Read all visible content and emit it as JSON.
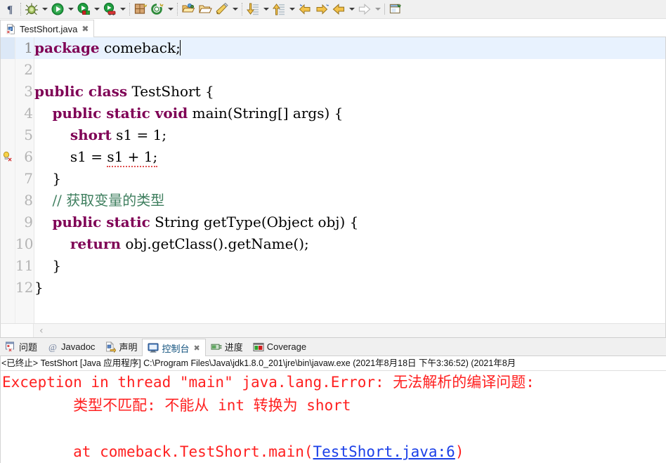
{
  "toolbar": {
    "items": [
      {
        "name": "paragraph-mark-icon",
        "type": "icon"
      },
      {
        "name": "separator-dots",
        "type": "sep-dots"
      },
      {
        "name": "debug-icon",
        "type": "icon"
      },
      {
        "name": "debug-dropdown-arrow",
        "type": "arrow"
      },
      {
        "name": "run-icon",
        "type": "icon"
      },
      {
        "name": "run-dropdown-arrow",
        "type": "arrow"
      },
      {
        "name": "run-coverage-icon",
        "type": "icon"
      },
      {
        "name": "coverage-dropdown-arrow",
        "type": "arrow"
      },
      {
        "name": "run-external-tools-icon",
        "type": "icon"
      },
      {
        "name": "external-tools-dropdown-arrow",
        "type": "arrow"
      },
      {
        "name": "separator-dots",
        "type": "sep-dots"
      },
      {
        "name": "new-java-package-icon",
        "type": "icon"
      },
      {
        "name": "new-java-class-icon",
        "type": "icon"
      },
      {
        "name": "new-wizard-dropdown-arrow",
        "type": "arrow"
      },
      {
        "name": "separator-dots",
        "type": "sep-dots"
      },
      {
        "name": "open-type-icon",
        "type": "icon"
      },
      {
        "name": "open-folder-icon",
        "type": "icon"
      },
      {
        "name": "java-perspective-icon",
        "type": "icon"
      },
      {
        "name": "perspective-dropdown-arrow",
        "type": "arrow"
      },
      {
        "name": "separator-dots",
        "type": "sep-dots"
      },
      {
        "name": "next-annotation-icon",
        "type": "icon"
      },
      {
        "name": "next-annotation-dropdown-arrow",
        "type": "arrow"
      },
      {
        "name": "previous-annotation-icon",
        "type": "icon"
      },
      {
        "name": "previous-annotation-dropdown-arrow",
        "type": "arrow"
      },
      {
        "name": "last-edit-location-icon",
        "type": "icon"
      },
      {
        "name": "forward-edit-location-icon",
        "type": "icon"
      },
      {
        "name": "back-navigation-icon",
        "type": "icon"
      },
      {
        "name": "back-dropdown-arrow",
        "type": "arrow"
      },
      {
        "name": "forward-navigation-icon",
        "type": "icon"
      },
      {
        "name": "forward-dropdown-arrow",
        "type": "arrow-dim"
      },
      {
        "name": "separator-line",
        "type": "sep"
      },
      {
        "name": "new-window-icon",
        "type": "icon"
      }
    ]
  },
  "editor": {
    "tab": {
      "label": "TestShort.java",
      "close_glyph": "✖",
      "icon_name": "java-file-error-icon"
    },
    "scroll_left_glyph": "‹",
    "lines": [
      {
        "num": "1",
        "highlight": true,
        "marker": null,
        "caret": true,
        "tokens": [
          {
            "t": "package",
            "c": "kw"
          },
          {
            "t": " comeback;",
            "c": "plain"
          }
        ]
      },
      {
        "num": "2",
        "highlight": false,
        "marker": null,
        "caret": false,
        "tokens": []
      },
      {
        "num": "3",
        "highlight": false,
        "marker": null,
        "caret": false,
        "tokens": [
          {
            "t": "public class",
            "c": "kw"
          },
          {
            "t": " TestShort {",
            "c": "plain"
          }
        ]
      },
      {
        "num": "4",
        "highlight": false,
        "marker": null,
        "caret": false,
        "tokens": [
          {
            "t": "    ",
            "c": "plain"
          },
          {
            "t": "public static void",
            "c": "kw"
          },
          {
            "t": " main(String[] args) {",
            "c": "plain"
          }
        ]
      },
      {
        "num": "5",
        "highlight": false,
        "marker": null,
        "caret": false,
        "tokens": [
          {
            "t": "        ",
            "c": "plain"
          },
          {
            "t": "short",
            "c": "kw"
          },
          {
            "t": " s1 = 1;",
            "c": "plain"
          }
        ]
      },
      {
        "num": "6",
        "highlight": false,
        "marker": "error-quickfix-icon",
        "caret": false,
        "tokens": [
          {
            "t": "        s1 = ",
            "c": "plain"
          },
          {
            "t": "s1 + 1;",
            "c": "plain squiggle"
          }
        ]
      },
      {
        "num": "7",
        "highlight": false,
        "marker": null,
        "caret": false,
        "tokens": [
          {
            "t": "    }",
            "c": "plain"
          }
        ]
      },
      {
        "num": "8",
        "highlight": false,
        "marker": null,
        "caret": false,
        "tokens": [
          {
            "t": "    ",
            "c": "plain"
          },
          {
            "t": "// 获取变量的类型",
            "c": "cmt"
          }
        ]
      },
      {
        "num": "9",
        "highlight": false,
        "marker": null,
        "caret": false,
        "tokens": [
          {
            "t": "    ",
            "c": "plain"
          },
          {
            "t": "public static",
            "c": "kw"
          },
          {
            "t": " String getType(Object obj) {",
            "c": "plain"
          }
        ]
      },
      {
        "num": "10",
        "highlight": false,
        "marker": null,
        "caret": false,
        "tokens": [
          {
            "t": "        ",
            "c": "plain"
          },
          {
            "t": "return",
            "c": "kw"
          },
          {
            "t": " obj.getClass().getName();",
            "c": "plain"
          }
        ]
      },
      {
        "num": "11",
        "highlight": false,
        "marker": null,
        "caret": false,
        "tokens": [
          {
            "t": "    }",
            "c": "plain"
          }
        ]
      },
      {
        "num": "12",
        "highlight": false,
        "marker": null,
        "caret": false,
        "tokens": [
          {
            "t": "}",
            "c": "plain"
          }
        ]
      }
    ]
  },
  "panel": {
    "tabs": [
      {
        "label": "问题",
        "icon": "problems-icon",
        "active": false,
        "closable": false
      },
      {
        "label": "Javadoc",
        "icon": "javadoc-at-icon",
        "active": false,
        "closable": false
      },
      {
        "label": "声明",
        "icon": "declaration-icon",
        "active": false,
        "closable": false
      },
      {
        "label": "控制台",
        "icon": "console-icon",
        "active": true,
        "closable": true
      },
      {
        "label": "进度",
        "icon": "progress-icon",
        "active": false,
        "closable": false
      },
      {
        "label": "Coverage",
        "icon": "coverage-icon",
        "active": false,
        "closable": false
      }
    ],
    "close_glyph": "✖"
  },
  "console": {
    "header": "<已终止> TestShort [Java 应用程序] C:\\Program Files\\Java\\jdk1.8.0_201\\jre\\bin\\javaw.exe  (2021年8月18日 下午3:36:52)   (2021年8月",
    "lines": [
      {
        "text": "Exception in thread \"main\" java.lang.Error: 无法解析的编译问题:",
        "link": null
      },
      {
        "text": "        类型不匹配: 不能从 int 转换为 short",
        "link": null
      },
      {
        "text": "",
        "link": null
      },
      {
        "pre": "        at comeback.TestShort.main(",
        "link": "TestShort.java:6",
        "post": ")"
      }
    ]
  },
  "colors": {
    "keyword": "#7F0055",
    "comment": "#3F7F5F",
    "error_text": "#FF2020",
    "link": "#1A3FE8",
    "highlight_line": "#E8F2FE",
    "toolbar_bg": "#F0F0F0"
  }
}
